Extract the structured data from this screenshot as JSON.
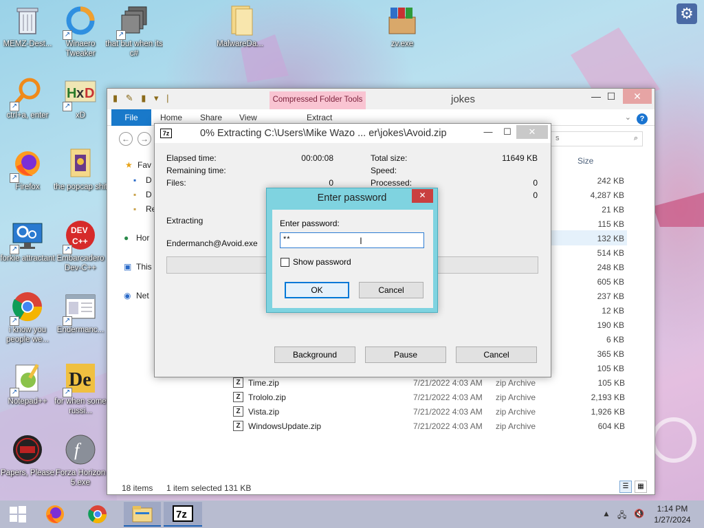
{
  "desktop": {
    "icons": [
      {
        "label": "MEMZ-Dest...",
        "icon": "recycle-bin-icon"
      },
      {
        "label": "Winaero Tweaker",
        "icon": "winaero-icon"
      },
      {
        "label": "that but when its c#",
        "icon": "stacked-windows-icon"
      },
      {
        "label": "MalwareDa...",
        "icon": "folder-icon"
      },
      {
        "label": "zv.exe",
        "icon": "winrar-box-icon"
      },
      {
        "label": "ctrl+a, enter",
        "icon": "magnifier-icon"
      },
      {
        "label": "xD",
        "icon": "hxd-icon"
      },
      {
        "label": "Firefox",
        "icon": "firefox-icon"
      },
      {
        "label": "the popcap shit",
        "icon": "popcap-folder-icon"
      },
      {
        "label": "forkie attractant",
        "icon": "settings-monitor-icon"
      },
      {
        "label": "Embarcadero Dev-C++",
        "icon": "dev-cpp-icon"
      },
      {
        "label": "i know you people we...",
        "icon": "chrome-icon"
      },
      {
        "label": "Endermanc...",
        "icon": "app-window-icon"
      },
      {
        "label": "Notepad++",
        "icon": "notepad-plus-plus-icon"
      },
      {
        "label": "for when some russi...",
        "icon": "delphi-icon"
      },
      {
        "label": "Papers, Please",
        "icon": "papers-please-icon"
      },
      {
        "label": "Forza Horizon 5.exe",
        "icon": "flash-icon"
      }
    ]
  },
  "explorer": {
    "title": "jokes",
    "context_tab": "Compressed Folder Tools",
    "tabs": {
      "file": "File",
      "home": "Home",
      "share": "Share",
      "view": "View",
      "extract": "Extract"
    },
    "search_placeholder": "s",
    "nav": [
      {
        "label": "Fav",
        "icon": "star-icon"
      },
      {
        "label": "D",
        "icon": "desktop-icon"
      },
      {
        "label": "D",
        "icon": "documents-icon"
      },
      {
        "label": "Re",
        "icon": "recent-icon"
      },
      {
        "label": "Hor",
        "icon": "homegroup-icon"
      },
      {
        "label": "This",
        "icon": "computer-icon"
      },
      {
        "label": "Net",
        "icon": "network-icon"
      }
    ],
    "size_header": "Size",
    "sizes": [
      "242 KB",
      "4,287 KB",
      "21 KB",
      "115 KB",
      "132 KB",
      "514 KB",
      "248 KB",
      "605 KB",
      "237 KB",
      "12 KB",
      "190 KB",
      "6 KB",
      "365 KB",
      "105 KB"
    ],
    "files": [
      {
        "name": "Time.zip",
        "date": "7/21/2022 4:03 AM",
        "type": "zip Archive",
        "size": "105 KB"
      },
      {
        "name": "Trololo.zip",
        "date": "7/21/2022 4:03 AM",
        "type": "zip Archive",
        "size": "2,193 KB"
      },
      {
        "name": "Vista.zip",
        "date": "7/21/2022 4:03 AM",
        "type": "zip Archive",
        "size": "1,926 KB"
      },
      {
        "name": "WindowsUpdate.zip",
        "date": "7/21/2022 4:03 AM",
        "type": "zip Archive",
        "size": "604 KB"
      }
    ],
    "status": {
      "items": "18 items",
      "selected": "1 item selected  131 KB"
    }
  },
  "zip": {
    "title": "0% Extracting C:\\Users\\Mike Wazo ... er\\jokes\\Avoid.zip",
    "logo": "7z",
    "elapsed_label": "Elapsed time:",
    "elapsed_value": "00:00:08",
    "remaining_label": "Remaining time:",
    "files_label": "Files:",
    "files_value": "0",
    "total_label": "Total size:",
    "total_value": "11649 KB",
    "speed_label": "Speed:",
    "processed_label": "Processed:",
    "processed_value": "0",
    "row4_value": "0",
    "extracting_label": "Extracting",
    "current_file": "Endermanch@Avoid.exe",
    "progress": 0,
    "buttons": {
      "background": "Background",
      "pause": "Pause",
      "cancel": "Cancel"
    }
  },
  "password_dialog": {
    "title": "Enter password",
    "label": "Enter password:",
    "value": "**",
    "show_password": "Show password",
    "ok": "OK",
    "cancel": "Cancel"
  },
  "taskbar": {
    "items": [
      "start-icon",
      "firefox-icon",
      "chrome-icon",
      "file-explorer-icon",
      "7zip-icon"
    ],
    "time": "1:14 PM",
    "date": "1/27/2024"
  }
}
